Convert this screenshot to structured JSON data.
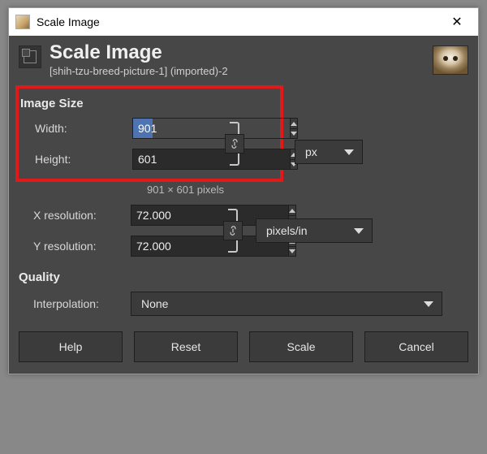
{
  "titlebar": {
    "title": "Scale Image"
  },
  "header": {
    "title": "Scale Image",
    "subtitle": "[shih-tzu-breed-picture-1] (imported)-2"
  },
  "image_size": {
    "heading": "Image Size",
    "width_label": "Width:",
    "height_label": "Height:",
    "width_value": "901",
    "height_value": "601",
    "unit": "px",
    "dims_text": "901 × 601 pixels"
  },
  "resolution": {
    "x_label": "X resolution:",
    "y_label": "Y resolution:",
    "x_value": "72.000",
    "y_value": "72.000",
    "unit": "pixels/in"
  },
  "quality": {
    "heading": "Quality",
    "interp_label": "Interpolation:",
    "interp_value": "None"
  },
  "buttons": {
    "help": "Help",
    "reset": "Reset",
    "scale": "Scale",
    "cancel": "Cancel"
  }
}
